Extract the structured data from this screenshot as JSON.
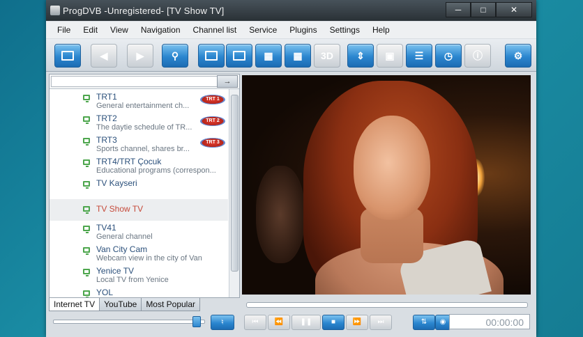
{
  "window": {
    "title": "ProgDVB -Unregistered- [TV Show TV]",
    "min_glyph": "─",
    "max_glyph": "□",
    "close_glyph": "✕"
  },
  "menu": [
    "File",
    "Edit",
    "View",
    "Navigation",
    "Channel list",
    "Service",
    "Plugins",
    "Settings",
    "Help"
  ],
  "toolbar": {
    "three_d_label": "3D"
  },
  "search": {
    "value": "",
    "go_glyph": "→"
  },
  "channels": [
    {
      "name": "TRT1",
      "desc": "General  entertainment ch...",
      "logo": "TRT 1"
    },
    {
      "name": "TRT2",
      "desc": "The daytie schedule of TR...",
      "logo": "TRT 2"
    },
    {
      "name": "TRT3",
      "desc": "Sports channel, shares br...",
      "logo": "TRT 3"
    },
    {
      "name": "TRT4/TRT Çocuk",
      "desc": "Educational programs (correspon..."
    },
    {
      "name": "TV Kayseri",
      "desc": ""
    },
    {
      "name": "TV Show TV",
      "desc": "",
      "selected": true
    },
    {
      "name": "TV41",
      "desc": "General channel"
    },
    {
      "name": "Van City Cam",
      "desc": "Webcam view in the city of Van"
    },
    {
      "name": "Yenice TV",
      "desc": "Local TV from Yenice"
    },
    {
      "name": "YOL",
      "desc": ""
    }
  ],
  "tabs": [
    "Internet TV",
    "YouTube",
    "Most Popular"
  ],
  "volume": {
    "level": 0.97
  },
  "playback": {
    "time": "00:00:00"
  },
  "colors": {
    "accent": "#2b86cf",
    "selected_text": "#c64a3a",
    "channel_text": "#2a4f7a"
  }
}
